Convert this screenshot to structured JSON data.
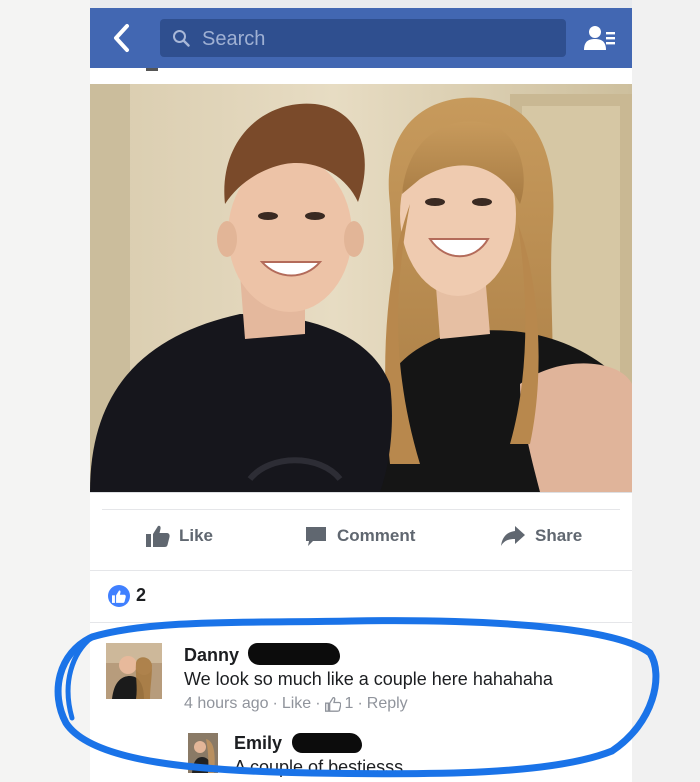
{
  "header": {
    "search_placeholder": "Search",
    "color": "#4267b2"
  },
  "post": {
    "actions": {
      "like_label": "Like",
      "comment_label": "Comment",
      "share_label": "Share"
    },
    "like_count": "2"
  },
  "comments": [
    {
      "name": "Danny",
      "text": "We look so much like a couple here hahahaha",
      "time": "4 hours ago",
      "like_label": "Like",
      "like_count": "1",
      "reply_label": "Reply"
    },
    {
      "name": "Emily",
      "text": "A couple of bestiesss"
    }
  ],
  "colors": {
    "highlight": "#1a73e8",
    "like_badge": "#4080ff"
  }
}
